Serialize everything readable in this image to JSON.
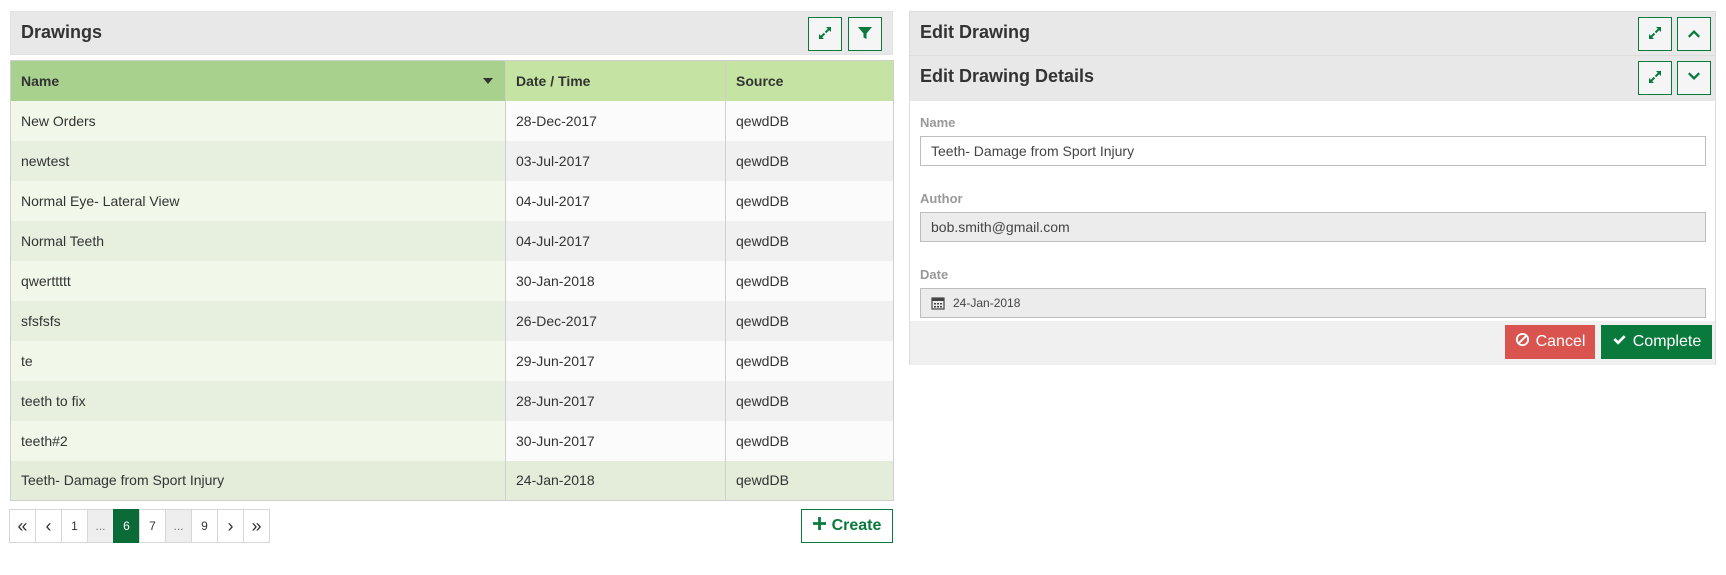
{
  "drawings_panel": {
    "title": "Drawings",
    "expand_icon": "expand-icon",
    "filter_icon": "filter-icon",
    "columns": [
      "Name",
      "Date / Time",
      "Source"
    ],
    "rows": [
      {
        "name": "New Orders",
        "date": "28-Dec-2017",
        "source": "qewdDB"
      },
      {
        "name": "newtest",
        "date": "03-Jul-2017",
        "source": "qewdDB"
      },
      {
        "name": "Normal Eye- Lateral View",
        "date": "04-Jul-2017",
        "source": "qewdDB"
      },
      {
        "name": "Normal Teeth",
        "date": "04-Jul-2017",
        "source": "qewdDB"
      },
      {
        "name": "qwerttttt",
        "date": "30-Jan-2018",
        "source": "qewdDB"
      },
      {
        "name": "sfsfsfs",
        "date": "26-Dec-2017",
        "source": "qewdDB"
      },
      {
        "name": "te",
        "date": "29-Jun-2017",
        "source": "qewdDB"
      },
      {
        "name": "teeth to fix",
        "date": "28-Jun-2017",
        "source": "qewdDB"
      },
      {
        "name": "teeth#2",
        "date": "30-Jun-2017",
        "source": "qewdDB"
      },
      {
        "name": "Teeth- Damage from Sport Injury",
        "date": "24-Jan-2018",
        "source": "qewdDB"
      }
    ],
    "selected_row": 9,
    "pagination": {
      "first": "«",
      "prev": "‹",
      "pages": [
        "1",
        "...",
        "6",
        "7",
        "...",
        "9"
      ],
      "active_page": "6",
      "next": "›",
      "last": "»"
    },
    "create_label": "Create"
  },
  "edit_panel": {
    "title": "Edit Drawing",
    "subtitle": "Edit Drawing Details",
    "fields": {
      "name_label": "Name",
      "name_value": "Teeth- Damage from Sport Injury",
      "author_label": "Author",
      "author_value": "bob.smith@gmail.com",
      "date_label": "Date",
      "date_value": "24-Jan-2018"
    },
    "cancel_label": "Cancel",
    "complete_label": "Complete"
  },
  "colors": {
    "accent_green": "#0a7a3c",
    "header_green": "#a9d18e",
    "header_light_green": "#c5e3a3",
    "cancel_red": "#d9534f"
  }
}
